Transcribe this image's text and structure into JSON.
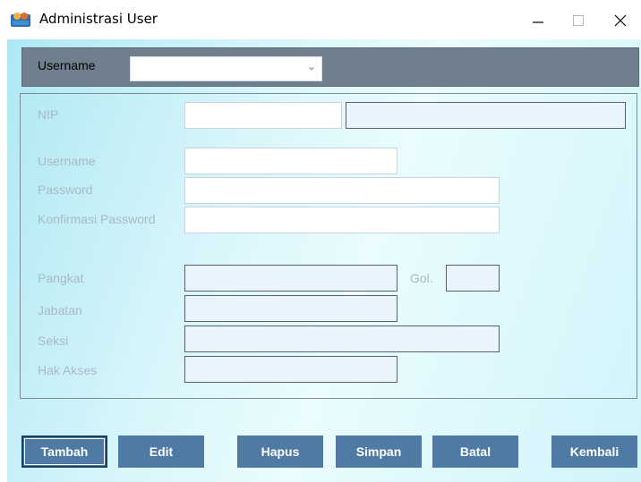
{
  "window": {
    "title": "Administrasi User"
  },
  "user_bar": {
    "label": "Username",
    "selected_value": ""
  },
  "form": {
    "nip_label": "NIP",
    "username_label": "Username",
    "password_label": "Password",
    "confirm_password_label": "Konfirmasi Password",
    "pangkat_label": "Pangkat",
    "gol_label": "Gol.",
    "jabatan_label": "Jabatan",
    "seksi_label": "Seksi",
    "hak_akses_label": "Hak Akses"
  },
  "buttons": {
    "tambah": "Tambah",
    "edit": "Edit",
    "hapus": "Hapus",
    "simpan": "Simpan",
    "batal": "Batal",
    "kembali": "Kembali"
  },
  "colors": {
    "button_bg": "#4e7aa4",
    "user_bar_bg": "#6f7f8e",
    "label_color": "#a9bac6"
  }
}
